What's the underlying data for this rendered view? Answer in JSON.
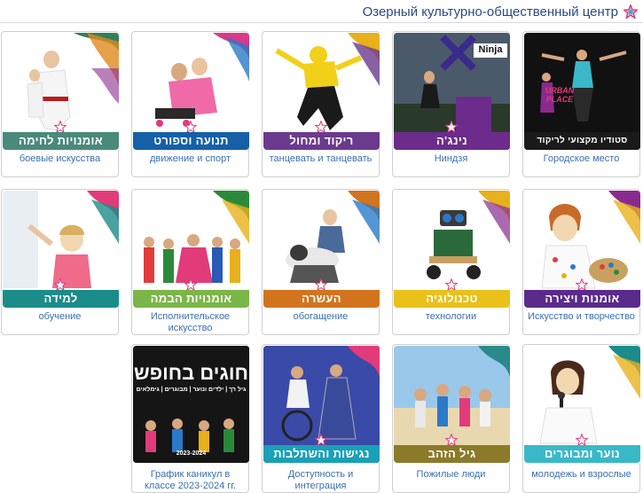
{
  "header": {
    "title": "Озерный культурно-общественный центр",
    "logo_icon": "star-logo-icon"
  },
  "cards": [
    {
      "id": "martial",
      "banner": "אומנויות לחימה",
      "caption": "боевые искусства",
      "color": "#4a8a7a"
    },
    {
      "id": "movement",
      "banner": "תנועה וספורט",
      "caption": "движение и спорт",
      "color": "#1560a8"
    },
    {
      "id": "dance",
      "banner": "ריקוד ומחול",
      "caption": "танцевать и танцевать",
      "color": "#6a3a8e"
    },
    {
      "id": "ninja",
      "banner": "נינג'ה",
      "caption": "Ниндзя",
      "color": "#6b2c8c",
      "photo_label": "Ninja"
    },
    {
      "id": "urban",
      "banner": "סטודיו מקצועי לריקוד",
      "caption": "Городское место",
      "color": "#1a1a1a",
      "photo_label": "URBAN PLACE"
    },
    {
      "id": "learning",
      "banner": "למידה",
      "caption": "обучение",
      "color": "#1a8c8a"
    },
    {
      "id": "stage",
      "banner": "אומנויות הבמה",
      "caption": "Исполнительское искусство",
      "color": "#7ab648"
    },
    {
      "id": "enrichment",
      "banner": "העשרה",
      "caption": "обогащение",
      "color": "#d2741e"
    },
    {
      "id": "technology",
      "banner": "טכנולוגיה",
      "caption": "технологии",
      "color": "#e9c11a"
    },
    {
      "id": "arts",
      "banner": "אומנות ויצירה",
      "caption": "Искусство и творчество",
      "color": "#5a2a8c"
    },
    {
      "id": "holiday",
      "banner": "",
      "caption": "График каникул в классе 2023-2024 гг.",
      "color": "#1a1a1a",
      "poster": {
        "title": "חוגים בחופש",
        "subtitle": "גיל רך | ילדים ונוער | מבוגרים | גימלאים",
        "year": "2023-2024"
      }
    },
    {
      "id": "accessibility",
      "banner": "נגישות והשתלבות",
      "caption": "Доступность и интеграция",
      "color": "#1aa0b8"
    },
    {
      "id": "golden",
      "banner": "גיל הזהב",
      "caption": "Пожилые люди",
      "color": "#8a7a2a"
    },
    {
      "id": "youth",
      "banner": "נוער ומבוגרים",
      "caption": "молодежь и взрослые",
      "color": "#3ab8c8"
    }
  ]
}
